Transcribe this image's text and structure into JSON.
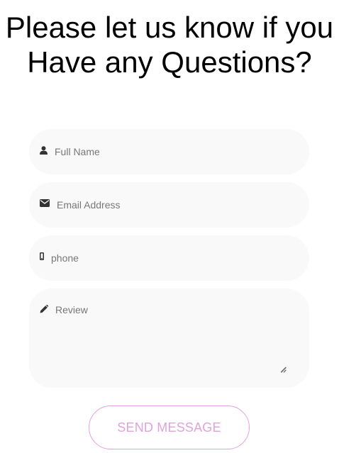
{
  "heading": {
    "title": "Please let us know if you Have any Questions?"
  },
  "form": {
    "full_name": {
      "placeholder": "Full Name",
      "icon": "user-icon"
    },
    "email": {
      "placeholder": "Email Address",
      "icon": "envelope-icon"
    },
    "phone": {
      "placeholder": "phone",
      "icon": "mobile-phone-icon"
    },
    "review": {
      "placeholder": "Review",
      "icon": "pencil-icon"
    },
    "submit_label": "SEND MESSAGE"
  },
  "colors": {
    "field_background": "#f9f9f9",
    "button_border": "#e5a0dc",
    "button_text": "#dfa3da",
    "placeholder_text": "#777777"
  }
}
